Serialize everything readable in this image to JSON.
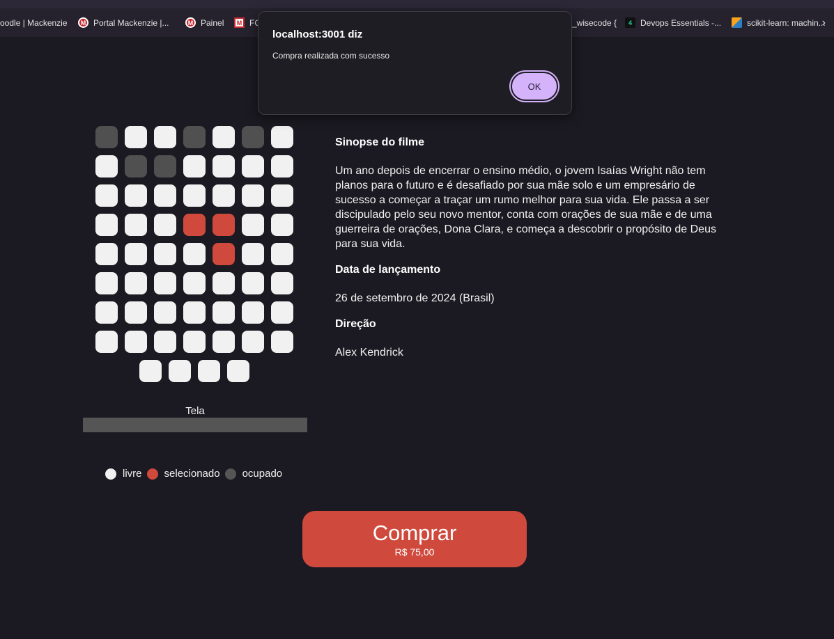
{
  "bookmarks": [
    {
      "label": "oodle | Mackenzie",
      "icon": "none"
    },
    {
      "label": "Portal Mackenzie |...",
      "icon": "mackenzie-icon"
    },
    {
      "label": "Painel",
      "icon": "mackenzie-icon"
    },
    {
      "label": "FC",
      "icon": "fc-icon"
    },
    {
      "label": "_wisecode {",
      "icon": "none"
    },
    {
      "label": "Devops Essentials -...",
      "icon": "devops-icon"
    },
    {
      "label": "scikit-learn: machin...",
      "icon": "scikit-learn-icon"
    }
  ],
  "dialog": {
    "title": "localhost:3001 diz",
    "message": "Compra realizada com sucesso",
    "ok_label": "OK"
  },
  "seats": {
    "rows": [
      [
        "ocupado",
        "livre",
        "livre",
        "ocupado",
        "livre",
        "ocupado",
        "livre"
      ],
      [
        "livre",
        "ocupado",
        "ocupado",
        "livre",
        "livre",
        "livre",
        "livre"
      ],
      [
        "livre",
        "livre",
        "livre",
        "livre",
        "livre",
        "livre",
        "livre"
      ],
      [
        "livre",
        "livre",
        "livre",
        "selecionado",
        "selecionado",
        "livre",
        "livre"
      ],
      [
        "livre",
        "livre",
        "livre",
        "livre",
        "selecionado",
        "livre",
        "livre"
      ],
      [
        "livre",
        "livre",
        "livre",
        "livre",
        "livre",
        "livre",
        "livre"
      ],
      [
        "livre",
        "livre",
        "livre",
        "livre",
        "livre",
        "livre",
        "livre"
      ],
      [
        "livre",
        "livre",
        "livre",
        "livre",
        "livre",
        "livre",
        "livre"
      ],
      [
        "livre",
        "livre",
        "livre",
        "livre"
      ]
    ]
  },
  "screen": {
    "label": "Tela"
  },
  "legend": {
    "livre": "livre",
    "selecionado": "selecionado",
    "ocupado": "ocupado"
  },
  "colors": {
    "livre": "#f1f1f1",
    "selecionado": "#cf4a3d",
    "ocupado": "#505050",
    "background": "#1b1a22",
    "dialog_ok": "#d4b3fb"
  },
  "movie": {
    "sinopse_heading": "Sinopse do filme",
    "sinopse": "Um ano depois de encerrar o ensino médio, o jovem Isaías Wright não tem planos para o futuro e é desafiado por sua mãe solo e um empresário de sucesso a começar a traçar um rumo melhor para sua vida. Ele passa a ser discipulado pelo seu novo mentor, conta com orações de sua mãe e de uma guerreira de orações, Dona Clara, e começa a descobrir o propósito de Deus para sua vida.",
    "data_heading": "Data de lançamento",
    "data": "26 de setembro de 2024 (Brasil)",
    "direcao_heading": "Direção",
    "direcao": "Alex Kendrick"
  },
  "purchase": {
    "button_label": "Comprar",
    "price": "R$ 75,00"
  }
}
